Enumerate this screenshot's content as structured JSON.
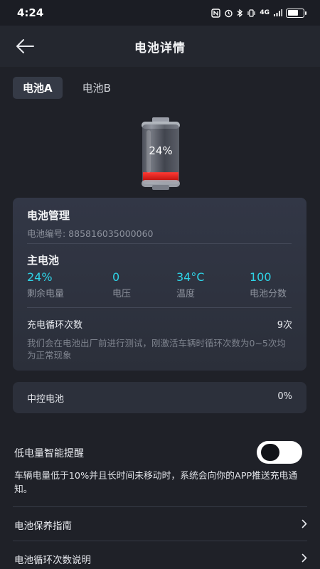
{
  "status_bar": {
    "time": "4:24",
    "network": "4G"
  },
  "header": {
    "title": "电池详情"
  },
  "tabs": [
    {
      "label": "电池A",
      "active": true
    },
    {
      "label": "电池B",
      "active": false
    }
  ],
  "battery": {
    "percent_label": "24%",
    "level": 0.24,
    "fill_color": "#e8201c"
  },
  "management": {
    "title": "电池管理",
    "serial": "电池编号: 885816035000060",
    "main_title": "主电池",
    "stats": [
      {
        "value": "24%",
        "label": "剩余电量"
      },
      {
        "value": "0",
        "label": "电压"
      },
      {
        "value": "34°C",
        "label": "温度"
      },
      {
        "value": "100",
        "label": "电池分数"
      }
    ],
    "cycle_label": "充电循环次数",
    "cycle_value": "9次",
    "note": "我们会在电池出厂前进行测试，刚激活车辆时循环次数为0~5次均为正常现象"
  },
  "central": {
    "label": "中控电池",
    "value": "0%"
  },
  "low_battery": {
    "label": "低电量智能提醒",
    "enabled": true,
    "description": "车辆电量低于10%并且长时间未移动时，系统会向你的APP推送充电通知。"
  },
  "menu": [
    {
      "label": "电池保养指南"
    },
    {
      "label": "电池循环次数说明"
    }
  ],
  "colors": {
    "accent": "#2ed3e6",
    "background": "#1f2128",
    "card": "#2c303b"
  }
}
